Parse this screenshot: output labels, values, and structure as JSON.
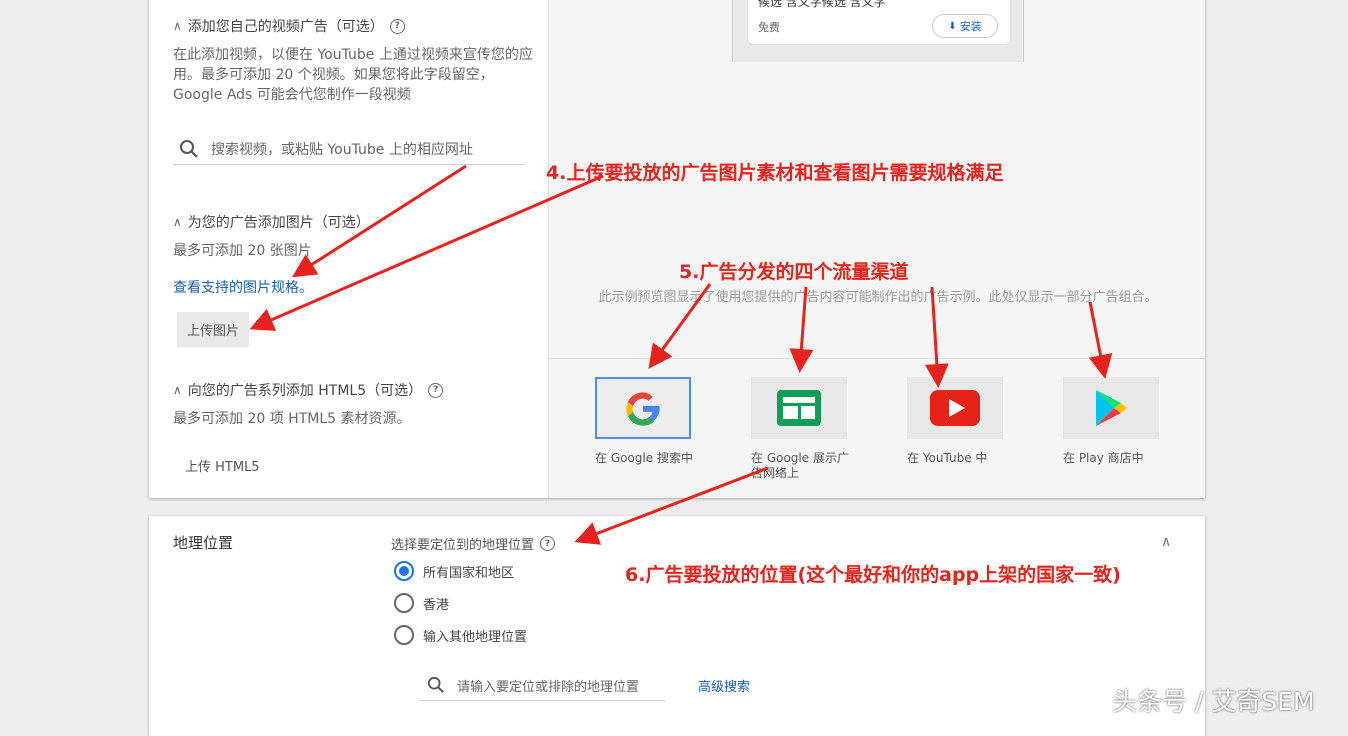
{
  "video_section": {
    "heading": "添加您自己的视频广告（可选）",
    "description": "在此添加视频，以便在 YouTube 上通过视频来宣传您的应用。最多可添加 20 个视频。如果您将此字段留空，Google Ads 可能会代您制作一段视频",
    "search_placeholder": "搜索视频，或粘贴 YouTube 上的相应网址"
  },
  "image_section": {
    "heading": "为您的广告添加图片（可选）",
    "limit": "最多可添加 20 张图片",
    "spec_link": "查看支持的图片规格。",
    "upload_button": "上传图片"
  },
  "html5_section": {
    "heading": "向您的广告系列添加 HTML5（可选）",
    "limit": "最多可添加 20 项 HTML5 素材资源。",
    "upload_button": "上传 HTML5"
  },
  "preview": {
    "app_name": "候选  含义字候选  含义字",
    "price": "免费",
    "install_button": "安装",
    "note": "此示例预览图显示了使用您提供的广告内容可能制作出的广告示例。此处仅显示一部分广告组合。",
    "channels": [
      {
        "label": "在 Google 搜索中",
        "icon": "google-g-icon"
      },
      {
        "label": "在 Google 展示广告网络上",
        "icon": "display-network-icon"
      },
      {
        "label": "在 YouTube 中",
        "icon": "youtube-icon"
      },
      {
        "label": "在 Play 商店中",
        "icon": "play-store-icon"
      }
    ]
  },
  "geo": {
    "title": "地理位置",
    "prompt": "选择要定位到的地理位置",
    "options": [
      "所有国家和地区",
      "香港",
      "输入其他地理位置"
    ],
    "selected_index": 0,
    "search_placeholder": "请输入要定位或排除的地理位置",
    "advanced_link": "高级搜索"
  },
  "annotations": {
    "a4": "4.上传要投放的广告图片素材和查看图片需要规格满足",
    "a5": "5.广告分发的四个流量渠道",
    "a6": "6.广告要投放的位置(这个最好和你的app上架的国家一致)"
  },
  "watermark": "头条号 / 艾奇SEM",
  "colors": {
    "annotation": "#e8231d",
    "link": "#1a5fb4",
    "radio_selected": "#1a73e8"
  }
}
